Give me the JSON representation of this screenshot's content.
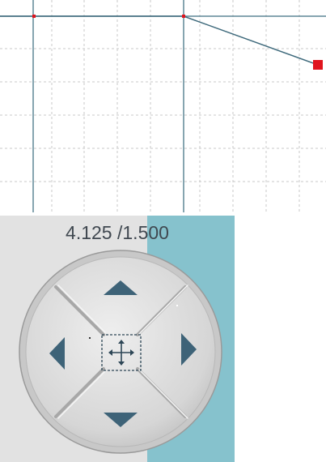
{
  "coordinate_readout": "4.125 /1.500",
  "colors": {
    "grid": "#c9c9c9",
    "axis": "#5e8796",
    "trace": "#3f6a7c",
    "point": "#e0141e",
    "panel_bg": "#e2e2e2",
    "panel_accent": "#86c2cd",
    "dpad_face": "#dcdcdc",
    "arrow": "#3e6378"
  },
  "dpad": {
    "up": {
      "icon": "arrow-up-icon"
    },
    "down": {
      "icon": "arrow-down-icon"
    },
    "left": {
      "icon": "arrow-left-icon"
    },
    "right": {
      "icon": "arrow-right-icon"
    },
    "center": {
      "icon": "move-icon"
    }
  }
}
